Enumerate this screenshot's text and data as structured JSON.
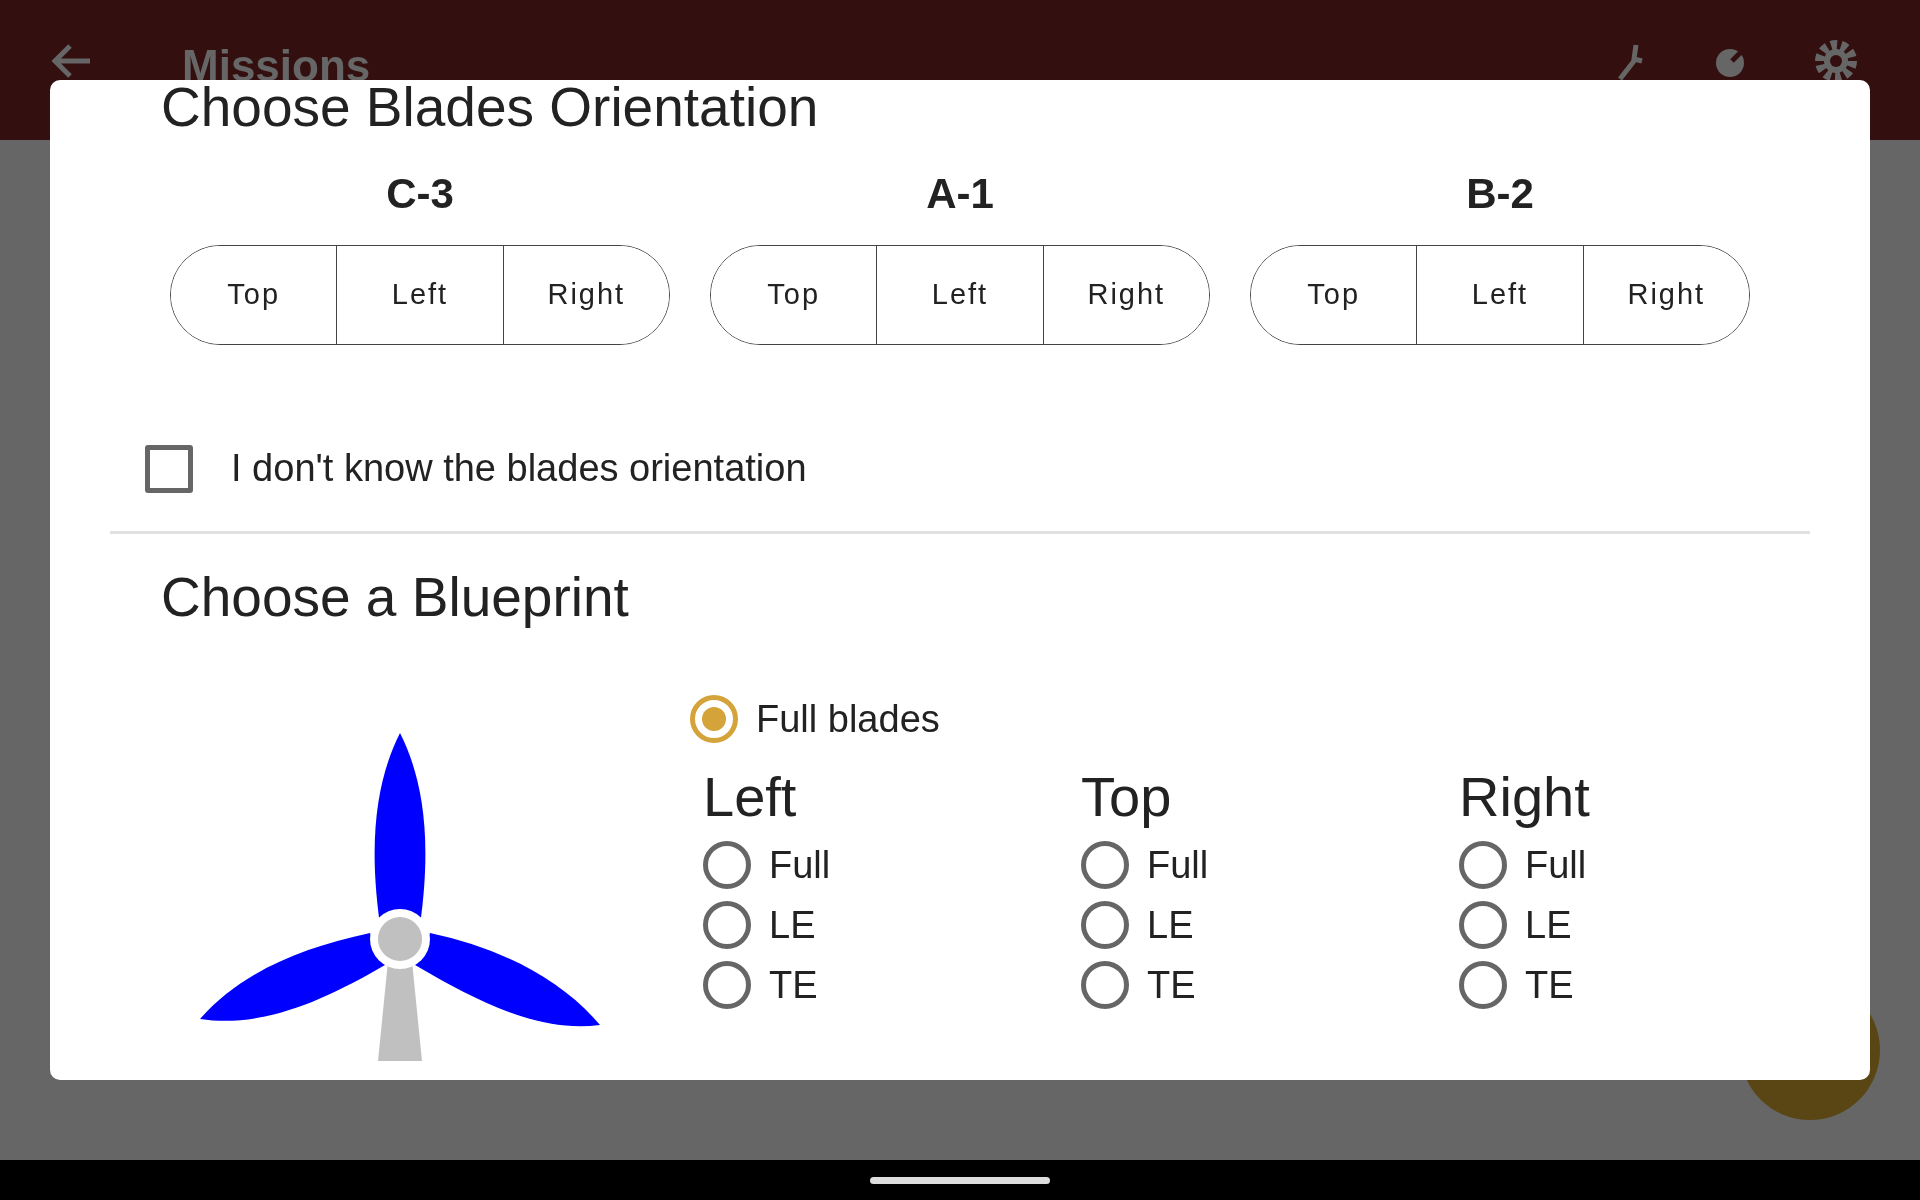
{
  "app_bar": {
    "title": "Missions"
  },
  "dialog": {
    "orientation": {
      "title": "Choose Blades Orientation",
      "blades": [
        {
          "name": "C-3",
          "options": [
            {
              "label": "Top",
              "selected": false
            },
            {
              "label": "Left",
              "selected": false
            },
            {
              "label": "Right",
              "selected": false
            }
          ]
        },
        {
          "name": "A-1",
          "options": [
            {
              "label": "Top",
              "selected": false
            },
            {
              "label": "Left",
              "selected": false
            },
            {
              "label": "Right",
              "selected": false
            }
          ]
        },
        {
          "name": "B-2",
          "options": [
            {
              "label": "Top",
              "selected": false
            },
            {
              "label": "Left",
              "selected": false
            },
            {
              "label": "Right",
              "selected": false
            }
          ]
        }
      ],
      "unknown": {
        "label": "I don't know the blades orientation",
        "checked": false
      }
    },
    "blueprint": {
      "title": "Choose a Blueprint",
      "full_blades": {
        "label": "Full blades",
        "selected": true
      },
      "columns": [
        {
          "heading": "Left",
          "options": [
            {
              "label": "Full",
              "selected": false
            },
            {
              "label": "LE",
              "selected": false
            },
            {
              "label": "TE",
              "selected": false
            }
          ]
        },
        {
          "heading": "Top",
          "options": [
            {
              "label": "Full",
              "selected": false
            },
            {
              "label": "LE",
              "selected": false
            },
            {
              "label": "TE",
              "selected": false
            }
          ]
        },
        {
          "heading": "Right",
          "options": [
            {
              "label": "Full",
              "selected": false
            },
            {
              "label": "LE",
              "selected": false
            },
            {
              "label": "TE",
              "selected": false
            }
          ]
        }
      ]
    }
  }
}
